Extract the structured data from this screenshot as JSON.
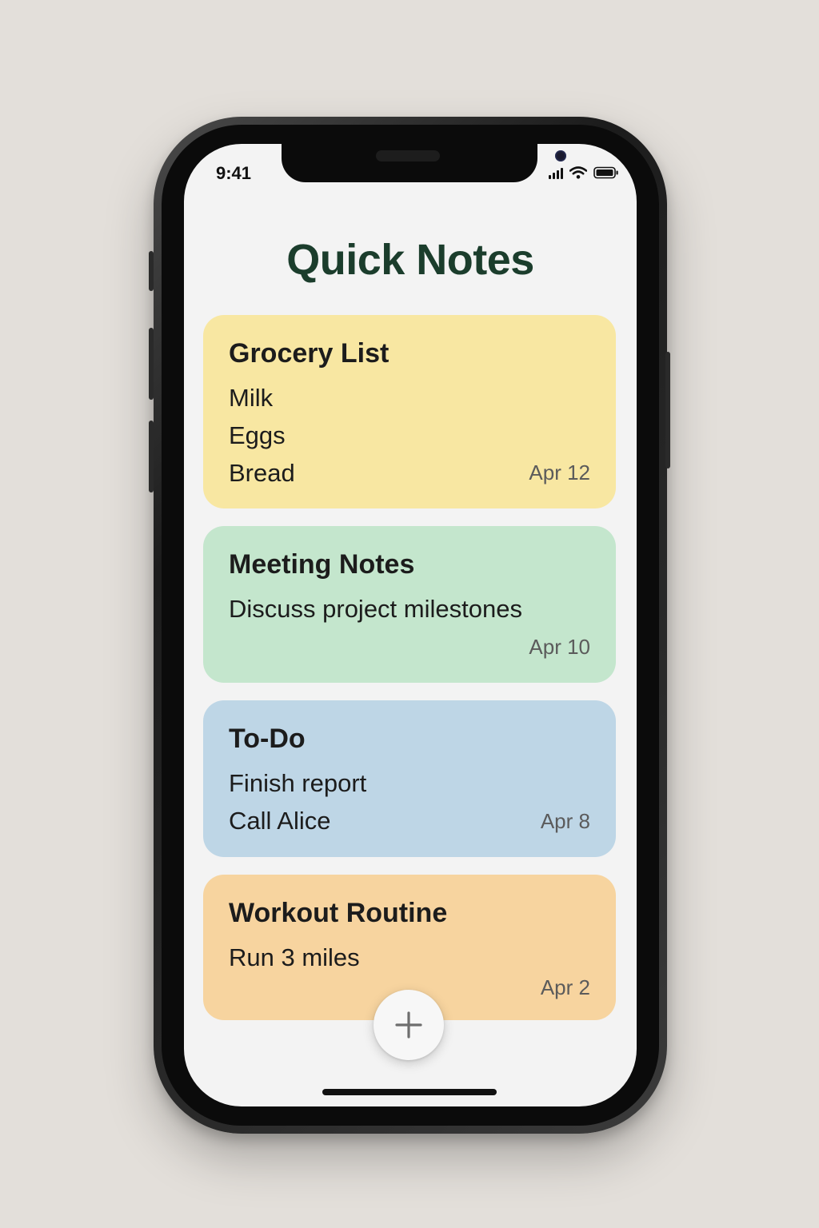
{
  "status_bar": {
    "time": "9:41"
  },
  "app": {
    "title": "Quick Notes"
  },
  "notes": [
    {
      "title": "Grocery List",
      "lines": [
        "Milk",
        "Eggs",
        "Bread"
      ],
      "date": "Apr 12",
      "color": "#f8e7a2"
    },
    {
      "title": "Meeting Notes",
      "lines": [
        "Discuss project milestones"
      ],
      "date": "Apr 10",
      "color": "#c4e6cd"
    },
    {
      "title": "To-Do",
      "lines": [
        "Finish report",
        "Call Alice"
      ],
      "date": "Apr 8",
      "color": "#bed6e6"
    },
    {
      "title": "Workout Routine",
      "lines": [
        "Run 3 miles"
      ],
      "date": "Apr 2",
      "color": "#f7d49f"
    }
  ],
  "fab": {
    "icon": "plus-icon"
  },
  "colors": {
    "title": "#1b3d2c",
    "background": "#f3f3f3"
  }
}
